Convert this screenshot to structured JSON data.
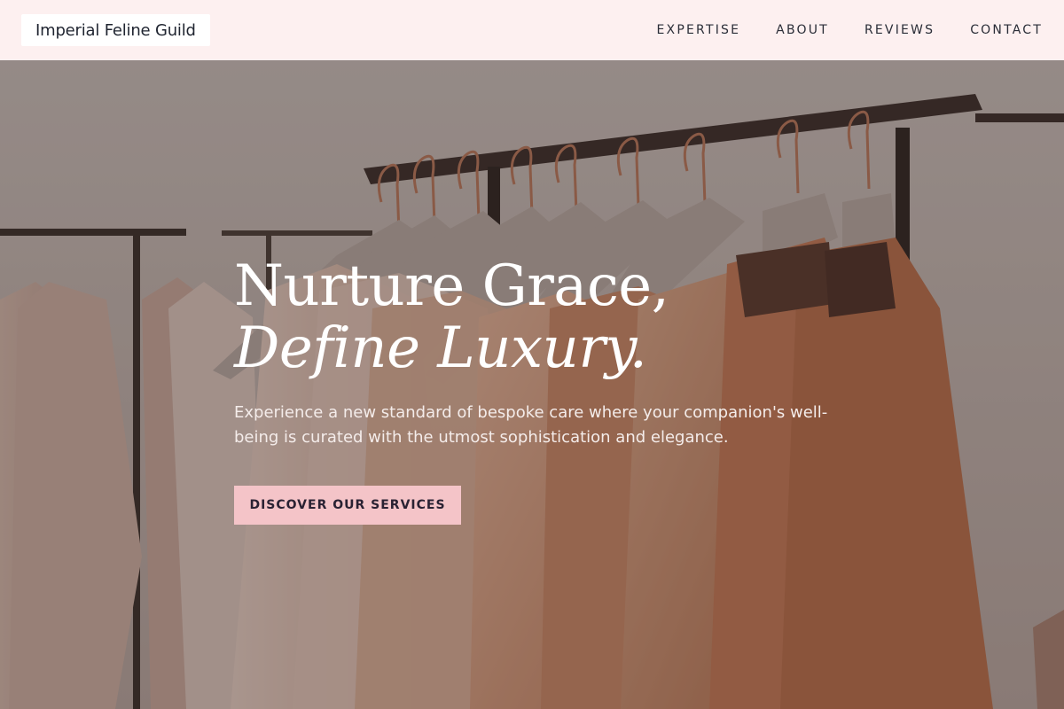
{
  "header": {
    "logo_text": "Imperial Feline Guild",
    "nav": [
      {
        "label": "EXPERTISE"
      },
      {
        "label": "ABOUT"
      },
      {
        "label": "REVIEWS"
      },
      {
        "label": "CONTACT"
      }
    ]
  },
  "hero": {
    "headline_line1": "Nurture Grace,",
    "headline_line2": "Define Luxury.",
    "subtext": "Experience a new standard of bespoke care where your companion's well-being is curated with the utmost sophistication and elegance.",
    "cta_label": "DISCOVER OUR SERVICES",
    "background_image": "clothing-rack-photo"
  },
  "colors": {
    "nav_bg": "#fdf0f0",
    "cta_bg": "#f4c4c8",
    "text_dark": "#2a2d37"
  }
}
